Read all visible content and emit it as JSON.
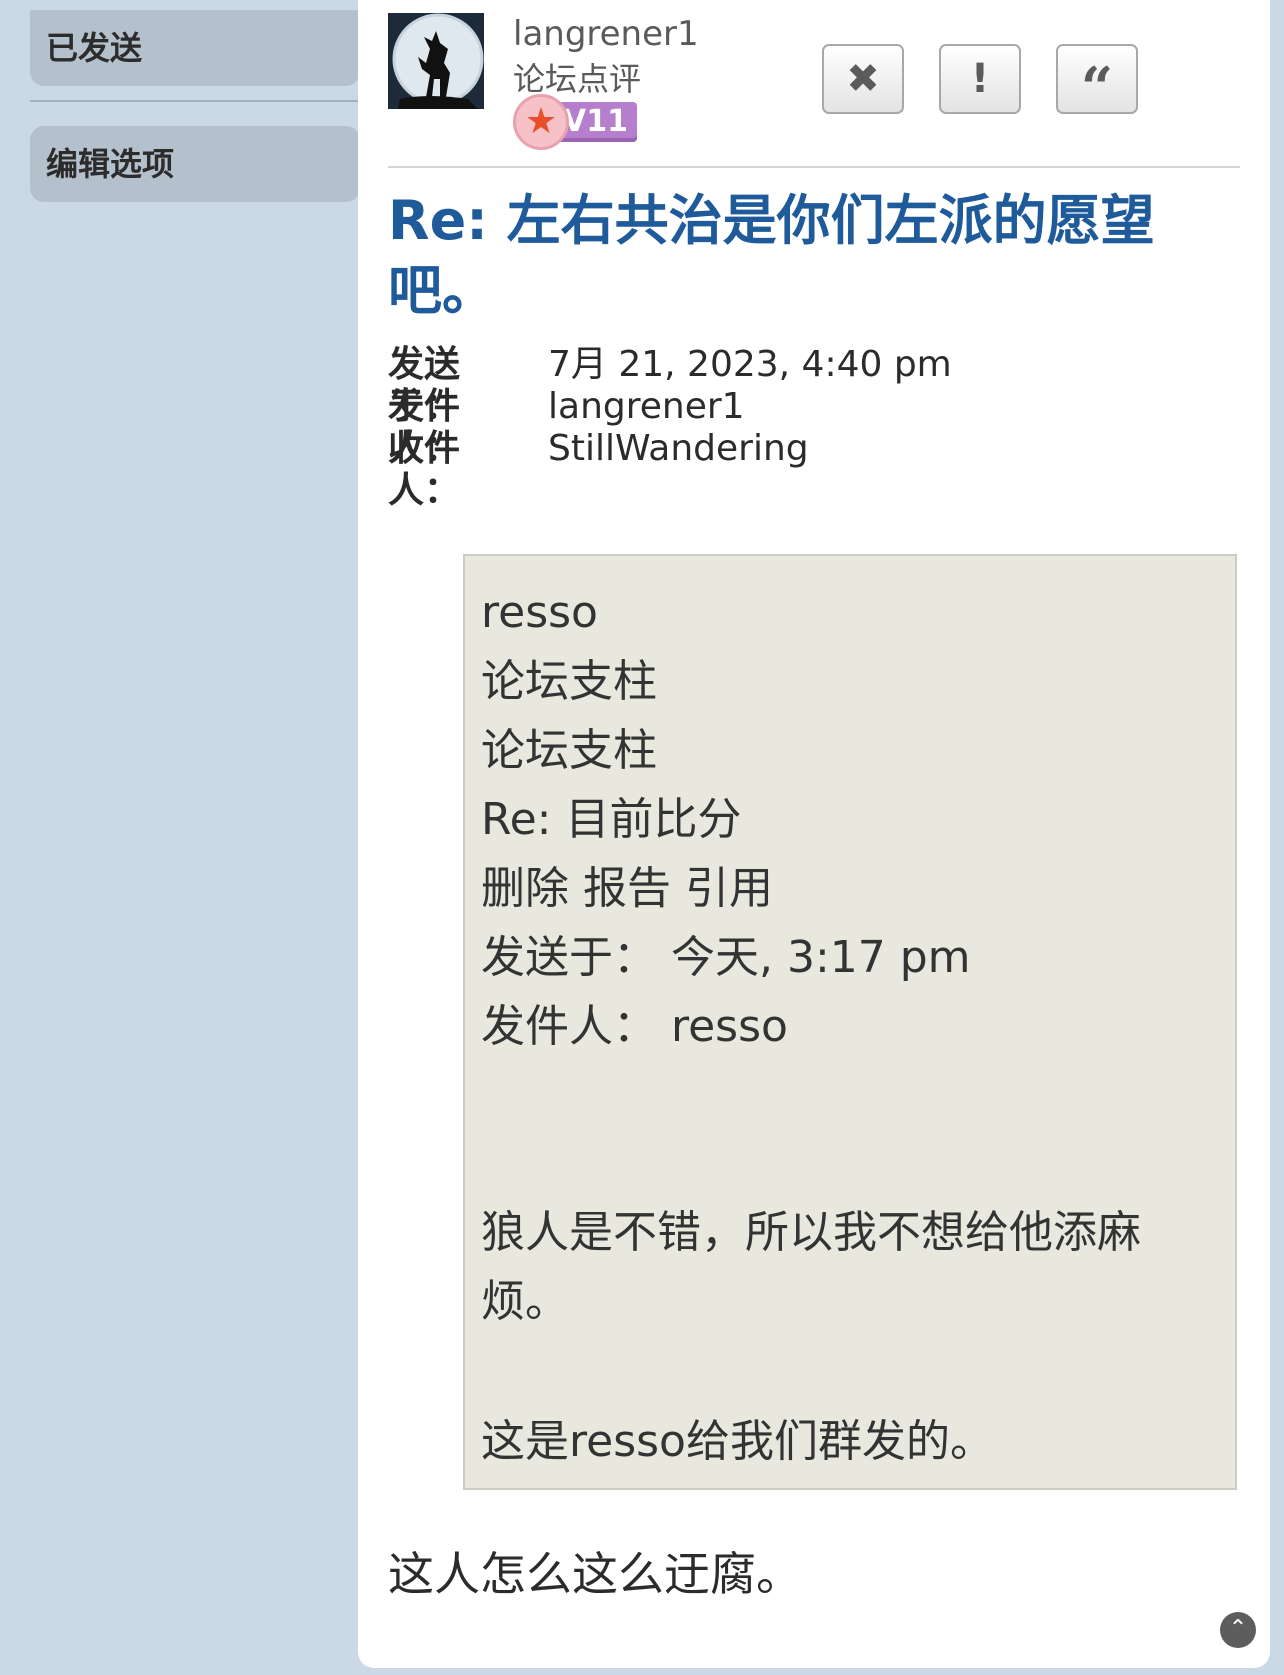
{
  "sidebar": {
    "sent_label": "已发送",
    "edit_options_label": "编辑选项"
  },
  "message": {
    "author": {
      "username": "langrener1",
      "rank": "论坛点评",
      "level": "LV11"
    },
    "actions": {
      "delete_icon": "close-icon",
      "report_icon": "exclamation-icon",
      "quote_icon": "quote-icon"
    },
    "title": "Re: 左右共治是你们左派的愿望吧。",
    "meta": {
      "sent_label": "发送于：",
      "sent_value": "7月 21, 2023, 4:40 pm",
      "from_label": "发件人：",
      "from_value": "langrener1",
      "to_label": "收件人：",
      "to_value": "StillWandering"
    },
    "quote": {
      "lines": [
        "resso",
        "论坛支柱",
        "论坛支柱",
        "Re: 目前比分",
        "删除 报告 引用",
        "发送于：  今天, 3:17 pm",
        "发件人：  resso"
      ],
      "paragraph1": "狼人是不错，所以我不想给他添麻烦。",
      "paragraph2": "这是resso给我们群发的。"
    },
    "body": "这人怎么这么迂腐。"
  },
  "scroll_top_icon": "chevron-up-icon"
}
